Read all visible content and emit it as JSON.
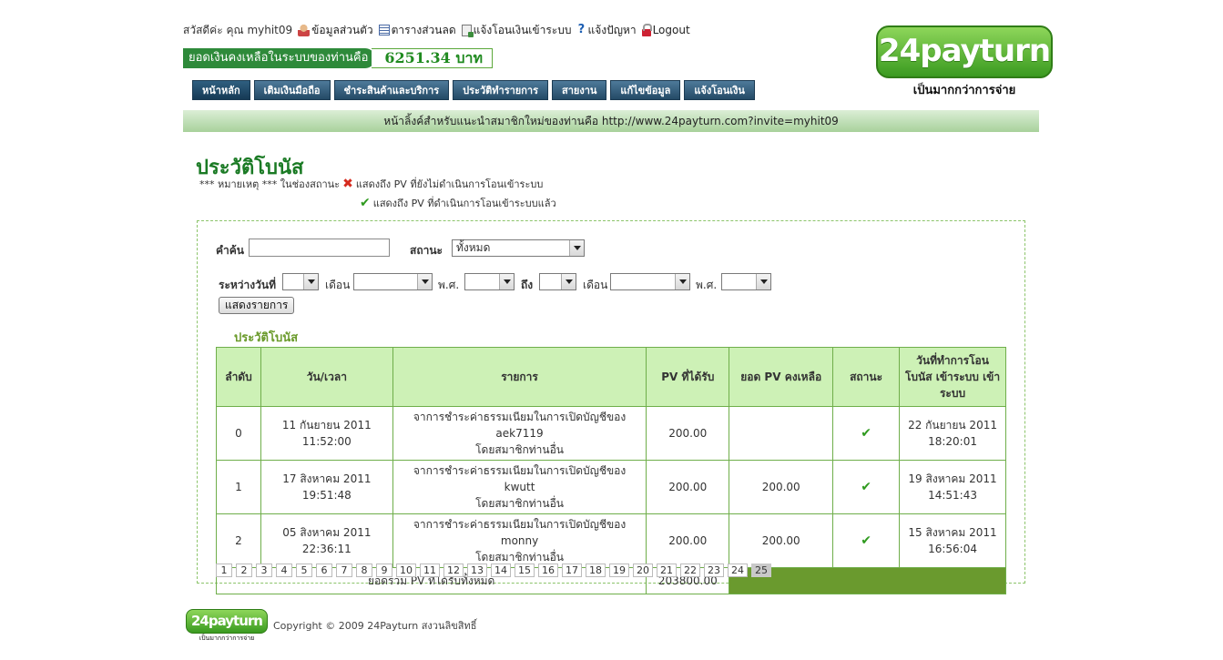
{
  "greeting": "สวัสดีค่ะ คุณ myhit09",
  "top_links": [
    {
      "label": "ข้อมูลส่วนตัว",
      "icon": "user-icon"
    },
    {
      "label": "ตารางส่วนลด",
      "icon": "table-icon"
    },
    {
      "label": "แจ้งโอนเงินเข้าระบบ",
      "icon": "document-icon"
    },
    {
      "label": "แจ้งปัญหา",
      "icon": "help-icon"
    },
    {
      "label": "Logout",
      "icon": "lock-icon"
    }
  ],
  "balance": {
    "label": "ยอดเงินคงเหลือในระบบของท่านคือ",
    "value": "6251.34 บาท"
  },
  "logo": {
    "text": "24payturn",
    "tagline": "เป็นมากกว่าการจ่าย"
  },
  "nav": [
    {
      "label": "หน้าหลัก"
    },
    {
      "label": "เติมเงินมือถือ"
    },
    {
      "label": "ชำระสินค้าและบริการ"
    },
    {
      "label": "ประวัติทำรายการ"
    },
    {
      "label": "สายงาน"
    },
    {
      "label": "แก้ไขข้อมูล"
    },
    {
      "label": "แจ้งโอนเงิน"
    }
  ],
  "invite_text": "หน้าลิ้งค์สำหรับแนะนำสมาชิกใหม่ของท่านคือ http://www.24payturn.com?invite=myhit09",
  "page_title": "ประวัติโบนัส",
  "notes": {
    "prefix": "*** หมายเหตุ *** ในช่องสถานะ",
    "x_text": "แสดงถึง PV ที่ยังไม่ดำเนินการโอนเข้าระบบ",
    "check_text": "แสดงถึง PV ที่ดำเนินการโอนเข้าระบบแล้ว",
    "x_symbol": "✖",
    "check_symbol": "✔"
  },
  "filter": {
    "search_label": "คำค้น",
    "search_value": "",
    "status_label": "สถานะ",
    "status_value": "ทั้งหมด",
    "between_label": "ระหว่างวันที่",
    "month_label": "เดือน",
    "year_label": "พ.ศ.",
    "to_label": "ถึง",
    "button": "แสดงรายการ"
  },
  "table_title": "ประวัติโบนัส",
  "table": {
    "headers": [
      "ลำดับ",
      "วัน/เวลา",
      "รายการ",
      "PV ที่ได้รับ",
      "ยอด PV คงเหลือ",
      "สถานะ",
      "วันที่ทำการโอน โบนัส เข้าระบบ เข้าระบบ"
    ],
    "rows": [
      {
        "no": "0",
        "date1": "11 กันยายน 2011",
        "time1": "11:52:00",
        "desc1": "จาการชำระค่าธรรมเนียมในการเปิดบัญชีของ aek7119",
        "desc2": "โดยสมาชิกท่านอื่น",
        "pv": "200.00",
        "remain": "",
        "status": "✔",
        "date2": "22 กันยายน 2011",
        "time2": "18:20:01"
      },
      {
        "no": "1",
        "date1": "17 สิงหาคม 2011",
        "time1": "19:51:48",
        "desc1": "จาการชำระค่าธรรมเนียมในการเปิดบัญชีของ kwutt",
        "desc2": "โดยสมาชิกท่านอื่น",
        "pv": "200.00",
        "remain": "200.00",
        "status": "✔",
        "date2": "19 สิงหาคม 2011",
        "time2": "14:51:43"
      },
      {
        "no": "2",
        "date1": "05 สิงหาคม 2011",
        "time1": "22:36:11",
        "desc1": "จาการชำระค่าธรรมเนียมในการเปิดบัญชีของ monny",
        "desc2": "โดยสมาชิกท่านอื่น",
        "pv": "200.00",
        "remain": "200.00",
        "status": "✔",
        "date2": "15 สิงหาคม 2011",
        "time2": "16:56:04"
      }
    ],
    "total_label": "ยอดรวม PV ที่ได้รับทั้งหมด",
    "total_value": "203800.00"
  },
  "pagination": [
    "1",
    "2",
    "3",
    "4",
    "5",
    "6",
    "7",
    "8",
    "9",
    "10",
    "11",
    "12",
    "13",
    "14",
    "15",
    "16",
    "17",
    "18",
    "19",
    "20",
    "21",
    "22",
    "23",
    "24",
    "25"
  ],
  "current_page": "25",
  "footer": {
    "logo_text": "24payturn",
    "logo_tagline": "เป็นมากกว่าการจ่าย",
    "copyright": "Copyright © 2009 24Payturn สงวนลิขสิทธิ์"
  },
  "colors": {
    "brand_green": "#3a9a20",
    "title_green": "#1a7a24",
    "nav_blue": "#244a66",
    "table_header": "#cdf1b6"
  }
}
